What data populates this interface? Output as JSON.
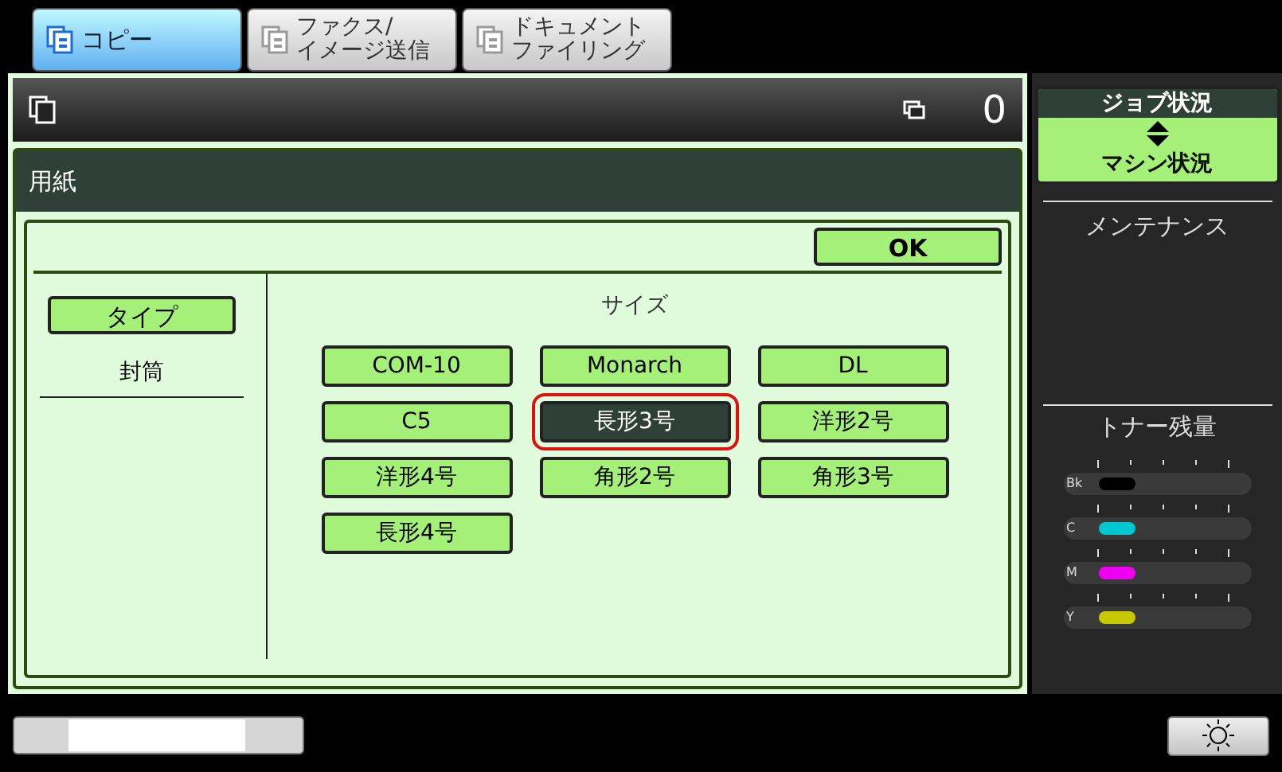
{
  "tabs": [
    {
      "lines": [
        "コピー"
      ],
      "selected": true
    },
    {
      "lines": [
        "ファクス/",
        "イメージ送信"
      ],
      "selected": false
    },
    {
      "lines": [
        "ドキュメント",
        "ファイリング"
      ],
      "selected": false
    }
  ],
  "header": {
    "counter": "0"
  },
  "dialog": {
    "title": "用紙",
    "ok": "OK",
    "type_button": "タイプ",
    "type_value": "封筒",
    "size_heading": "サイズ",
    "sizes": [
      {
        "label": "COM-10",
        "selected": false
      },
      {
        "label": "Monarch",
        "selected": false
      },
      {
        "label": "DL",
        "selected": false
      },
      {
        "label": "C5",
        "selected": false
      },
      {
        "label": "長形3号",
        "selected": true
      },
      {
        "label": "洋形2号",
        "selected": false
      },
      {
        "label": "洋形4号",
        "selected": false
      },
      {
        "label": "角形2号",
        "selected": false
      },
      {
        "label": "角形3号",
        "selected": false
      },
      {
        "label": "長形4号",
        "selected": false
      }
    ]
  },
  "sidebar": {
    "status_top": "ジョブ状況",
    "status_bottom": "マシン状況",
    "maintenance": "メンテナンス",
    "toner_title": "トナー残量",
    "toner": [
      {
        "label": "Bk",
        "color": "#000000",
        "level": 0.25
      },
      {
        "label": "C",
        "color": "#00c8d0",
        "level": 0.25
      },
      {
        "label": "M",
        "color": "#f000f0",
        "level": 0.25
      },
      {
        "label": "Y",
        "color": "#c8c800",
        "level": 0.25
      }
    ]
  }
}
